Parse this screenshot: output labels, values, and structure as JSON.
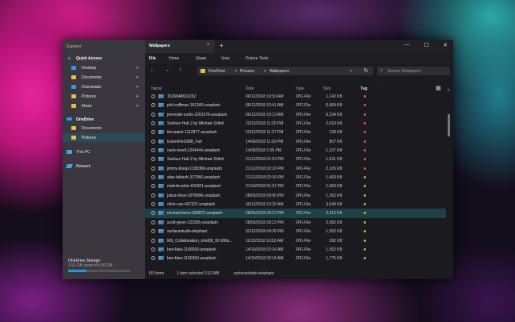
{
  "sidebar": {
    "title": "Explorer",
    "quick_access": "Quick Access",
    "items": [
      {
        "label": "Desktop",
        "icon": "desktop-icon",
        "color": "#2f9be0"
      },
      {
        "label": "Documents",
        "icon": "folder-icon",
        "color": "#e6c04a"
      },
      {
        "label": "Downloads",
        "icon": "download-icon",
        "color": "#2f9be0"
      },
      {
        "label": "Pictures",
        "icon": "folder-icon",
        "color": "#e6c04a"
      },
      {
        "label": "Music",
        "icon": "folder-icon",
        "color": "#e6c04a"
      }
    ],
    "onedrive": "OneDrive",
    "onedrive_items": [
      {
        "label": "Documents"
      },
      {
        "label": "Pictures"
      }
    ],
    "this_pc": "This PC",
    "network": "Network",
    "storage_label": "OneDrive Storage:",
    "storage_sub": "1.51 GB used of 5.00 GB",
    "storage_fraction": 0.3
  },
  "tab": {
    "title": "Wallpapers",
    "close": "×",
    "new": "+"
  },
  "window_controls": {
    "minimize": "—",
    "maximize": "☐",
    "close": "✕"
  },
  "ribbon": [
    "File",
    "Home",
    "Share",
    "View",
    "Picture Tools"
  ],
  "nav": {
    "back": "←",
    "forward": "→",
    "up": "↑",
    "path": [
      "OneDrive",
      ">",
      "Pictures",
      ">",
      "Wallpapers"
    ],
    "dropdown": "⌄",
    "refresh": "↻"
  },
  "search": {
    "placeholder": "Search Wallpapers",
    "icon": "⌕"
  },
  "columns": {
    "name": "Name",
    "date": "Date",
    "type": "Type",
    "size": "Size",
    "tag": "Tag",
    "sort": "↑",
    "grid": "▦"
  },
  "files": [
    {
      "name": "1526648631252",
      "date": "06/12/2018 10:53 AM",
      "type": "JPG File",
      "size": "1,142 KB",
      "tag": "#e0523a"
    },
    {
      "name": "phil-coffman-161240-unsplash",
      "date": "06/12/2018 10:41 AM",
      "type": "JPG File",
      "size": "6,664 KB",
      "tag": "#e0523a"
    },
    {
      "name": "jeremiah-curtis-1201276-unsplash",
      "date": "06/12/2018 10:13 AM",
      "type": "JPG File",
      "size": "6,334 KB",
      "tag": "#e0523a"
    },
    {
      "name": "Surface Hub 2 by Michael Gillett",
      "date": "22/12/2018 11:20 PM",
      "type": "JPG File",
      "size": "2,610 KB",
      "tag": "#e0523a"
    },
    {
      "name": "tim-patch-1112877-unsplash",
      "date": "23/12/2018 11:37 PM",
      "type": "JPG File",
      "size": "128 KB",
      "tag": "#e0523a"
    },
    {
      "name": "luSemNoG588_Full",
      "date": "14/08/2018 11:03 PM",
      "type": "JPG File",
      "size": "807 KB",
      "tag": "#e0523a"
    },
    {
      "name": "carlo-lovell-1204444-unsplash",
      "date": "14/08/2018 1:05 PM",
      "type": "JPG File",
      "size": "1,107 KB",
      "tag": "#e0523a"
    },
    {
      "name": "Surface Hub 2 by Michael Gillett",
      "date": "21/12/2018 01:53 PM",
      "type": "JPG File",
      "size": "1,621 KB",
      "tag": "#e0523a"
    },
    {
      "name": "jimmy-bisop-1138388-unsplash",
      "date": "21/12/2018 02:10 PM",
      "type": "JPG File",
      "size": "2,105 KB",
      "tag": "#e0523a"
    },
    {
      "name": "alan-labisch-327956-unsplash",
      "date": "21/12/2018 02:10 PM",
      "type": "JPG File",
      "size": "1,663 KB",
      "tag": "#8cc63f"
    },
    {
      "name": "matt-bruckie-432421-unsplash",
      "date": "31/10/2018 01:01 PM",
      "type": "JPG File",
      "size": "1,663 KB",
      "tag": "#8cc63f"
    },
    {
      "name": "julius-drost-1078806-unsplash",
      "date": "28/05/2018 09:00 PM",
      "type": "JPG File",
      "size": "1,262 KB",
      "tag": "#8cc63f"
    },
    {
      "name": "chris-coe-407337-unsplash",
      "date": "30/12/2018 12:20 AM",
      "type": "JPG File",
      "size": "3,540 KB",
      "tag": "#8cc63f"
    },
    {
      "name": "michael-benz-189972-unsplash",
      "date": "28/05/2018 09:12 PM",
      "type": "JPG File",
      "size": "2,512 KB",
      "tag": "#8cc63f"
    },
    {
      "name": "scott-greer-122395-unsplash",
      "date": "28/05/2018 09:12 PM",
      "type": "JPG File",
      "size": "2,062 KB",
      "tag": "#8cc63f"
    },
    {
      "name": "surfacestudio-elephant",
      "date": "02/12/2018 04:28 PM",
      "type": "JPG File",
      "size": "1,552 KB",
      "tag": "#8cc63f"
    },
    {
      "name": "MS_Collaboration_shot08_02-900x...",
      "date": "11/12/2018 10:52 AM",
      "type": "JPG File",
      "size": "262 KB",
      "tag": "#8cc63f"
    },
    {
      "name": "ben-klea-1199393-unsplash",
      "date": "14/10/2018 02:16 AM",
      "type": "JPG File",
      "size": "1,552 KB",
      "tag": "#8cc63f"
    },
    {
      "name": "ben-klea-1199393-unsplash",
      "date": "14/10/2018 02:16 AM",
      "type": "JPG File",
      "size": "1,775 KB",
      "tag": "#8cc63f"
    }
  ],
  "status": {
    "count": "60 Items",
    "selected": "1 item selected 2.62 MB",
    "file": "surfacestudio-elephant"
  },
  "colors": {
    "accent": "#1e9ad6",
    "selected_row": "#1d4146"
  }
}
